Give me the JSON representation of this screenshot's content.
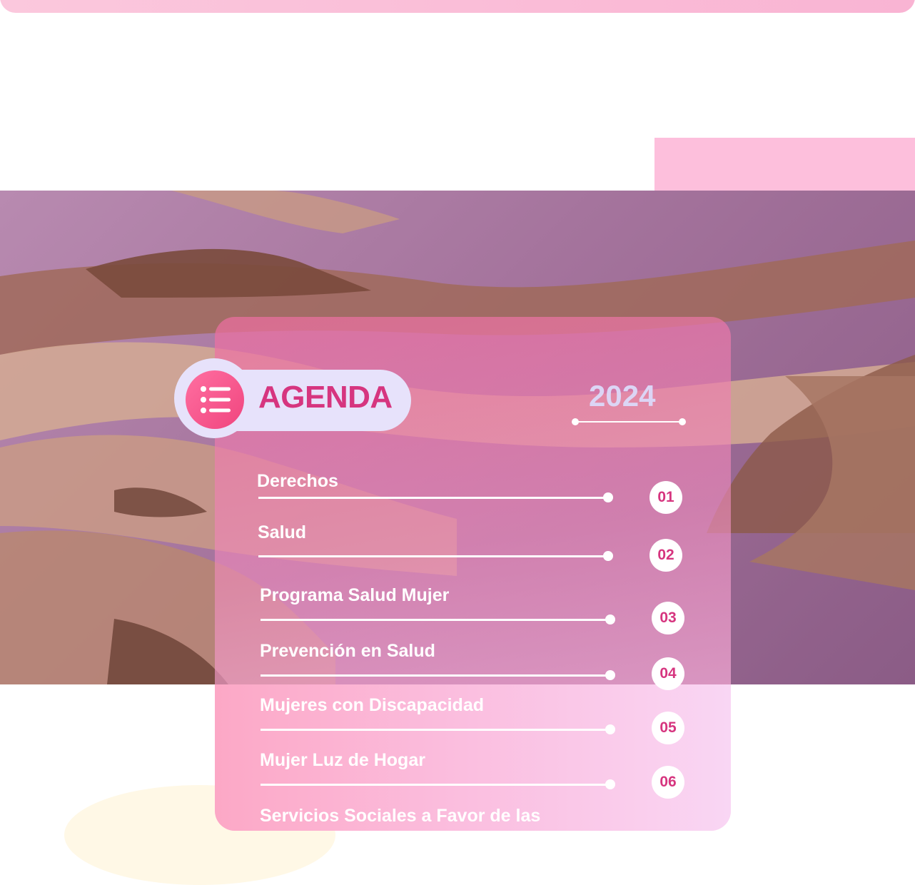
{
  "header": {},
  "agenda": {
    "title": "AGENDA",
    "year": "2024",
    "icon": "list-icon"
  },
  "items": [
    {
      "label": "Derechos",
      "number": "01"
    },
    {
      "label": "Salud",
      "number": "02"
    },
    {
      "label": "Programa Salud Mujer",
      "number": "03"
    },
    {
      "label": "Prevención en Salud",
      "number": "04"
    },
    {
      "label": "Mujeres con Discapacidad",
      "number": "05"
    },
    {
      "label": "Mujer Luz de Hogar",
      "number": "06"
    },
    {
      "label": "Servicios Sociales a Favor de las",
      "number": ""
    }
  ],
  "colors": {
    "accent": "#d6357f",
    "pink_light": "#fdbfdc",
    "lavender": "#e7e2fb",
    "icon_gradient_start": "#ff6fa1",
    "icon_gradient_end": "#f0457e"
  },
  "image": {
    "subject": "hands-photo"
  }
}
